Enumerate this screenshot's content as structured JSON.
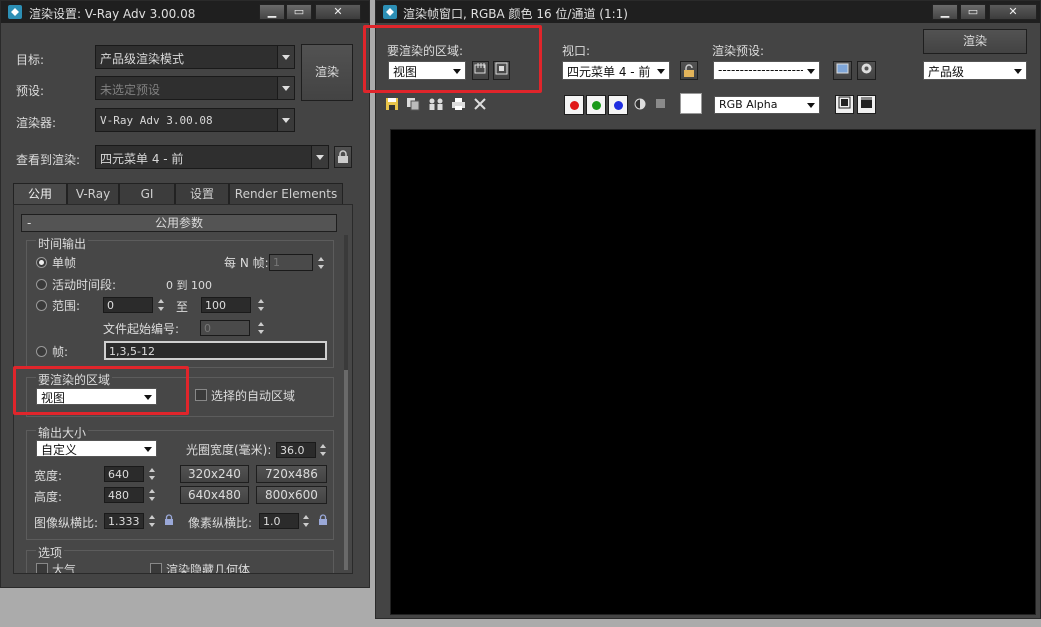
{
  "render_setup": {
    "title": "渲染设置: V-Ray Adv 3.00.08",
    "target_label": "目标:",
    "target_value": "产品级渲染模式",
    "preset_label": "预设:",
    "preset_value": "未选定预设",
    "renderer_label": "渲染器:",
    "renderer_value": "V-Ray Adv 3.00.08",
    "view_label": "查看到渲染:",
    "view_value": "四元菜单 4 - 前",
    "render_button": "渲染",
    "tabs": [
      "公用",
      "V-Ray",
      "GI",
      "设置",
      "Render Elements"
    ],
    "rollout_title": "公用参数",
    "rollout_toggle": "-",
    "time_output": {
      "group": "时间输出",
      "single": "单帧",
      "every_n": "每 N 帧:",
      "every_n_value": "1",
      "active_segment": "活动时间段:",
      "active_range": "0 到 100",
      "range": "范围:",
      "range_from": "0",
      "to": "至",
      "range_to": "100",
      "file_start": "文件起始编号:",
      "file_start_value": "0",
      "frames": "帧:",
      "frames_value": "1,3,5-12"
    },
    "area": {
      "group": "要渲染的区域",
      "value": "视图",
      "auto_region": "选择的自动区域"
    },
    "output_size": {
      "group": "输出大小",
      "preset": "自定义",
      "aperture_label": "光圈宽度(毫米):",
      "aperture_value": "36.0",
      "width_label": "宽度:",
      "width_value": "640",
      "height_label": "高度:",
      "height_value": "480",
      "presets": [
        "320x240",
        "720x486",
        "640x480",
        "800x600"
      ],
      "image_aspect_label": "图像纵横比:",
      "image_aspect_value": "1.333",
      "pixel_aspect_label": "像素纵横比:",
      "pixel_aspect_value": "1.0"
    },
    "options": {
      "group": "选项",
      "atmosphere": "大气",
      "hidden_geometry": "渲染隐藏几何体"
    }
  },
  "frame_window": {
    "title": "渲染帧窗口, RGBA 颜色 16 位/通道 (1:1)",
    "area_label": "要渲染的区域:",
    "area_value": "视图",
    "viewport_label": "视口:",
    "viewport_value": "四元菜单 4 - 前",
    "preset_label": "渲染预设:",
    "preset_value": "--------------------",
    "render_button": "渲染",
    "quality_value": "产品级",
    "channel_value": "RGB Alpha"
  },
  "colors": {
    "highlight": "#e0252b",
    "panel": "#444444",
    "canvas": "#000000"
  }
}
